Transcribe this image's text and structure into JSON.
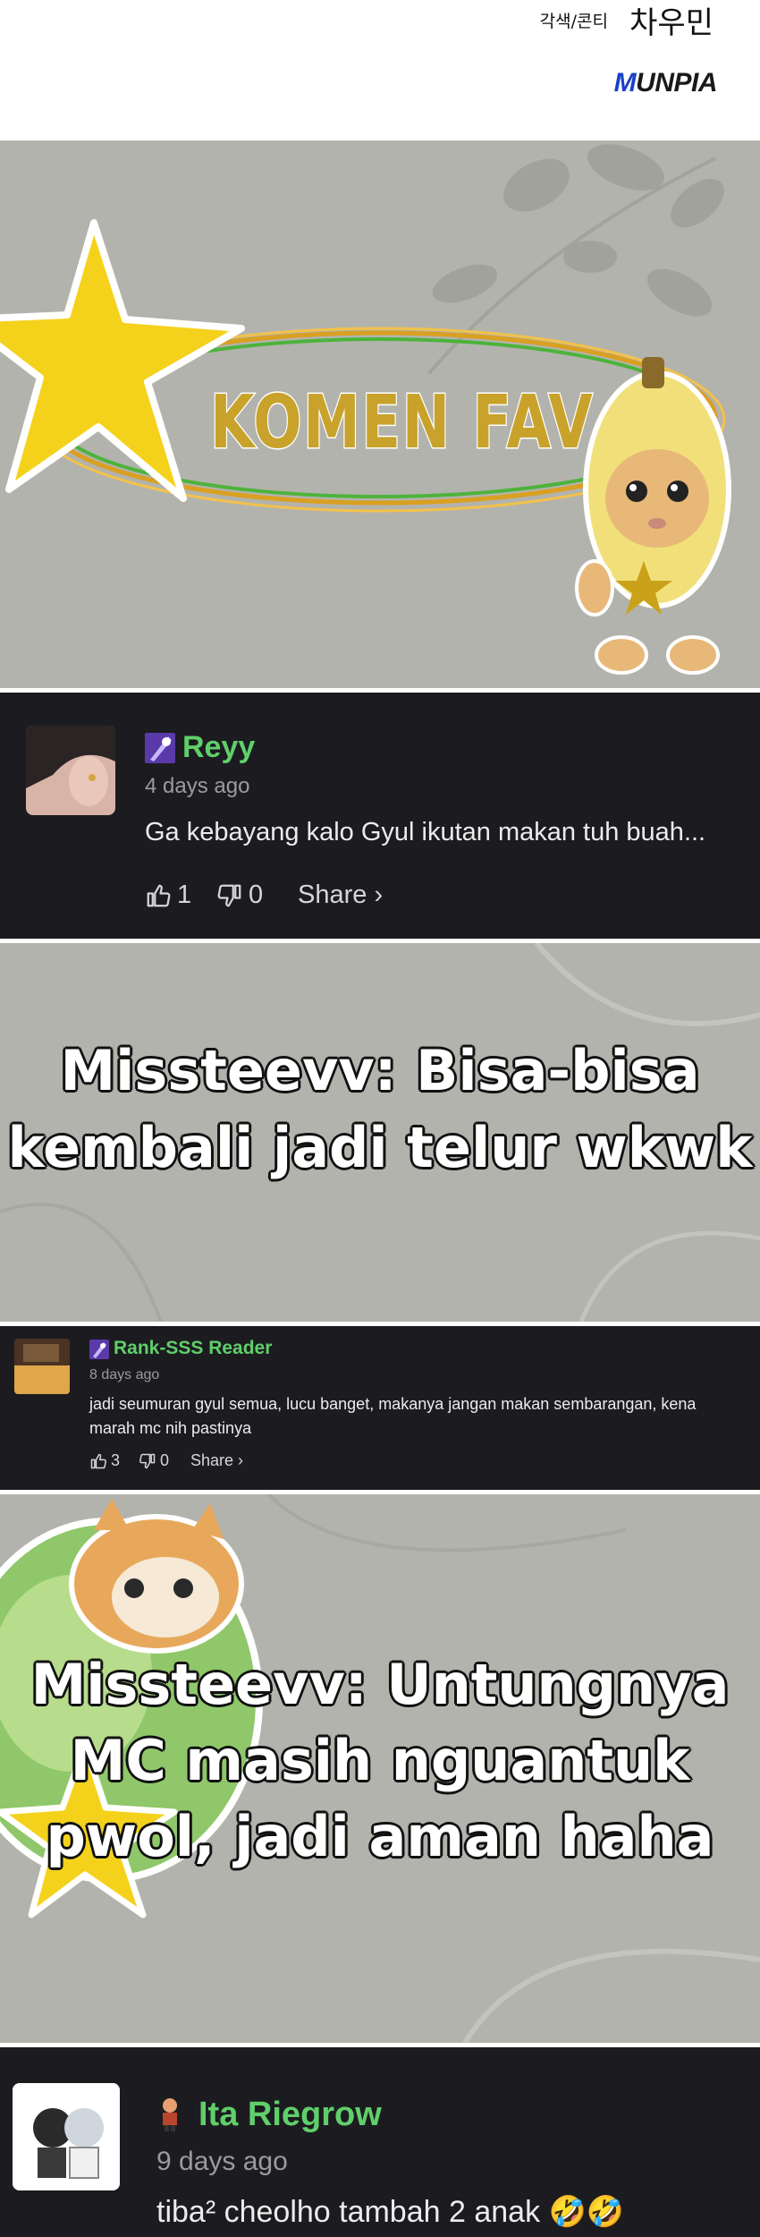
{
  "header": {
    "credit_role": "각색/콘티",
    "credit_name": "차우민",
    "brand_m": "M",
    "brand_rest": "UNPIA"
  },
  "banner": {
    "title": "KOMEN FAV"
  },
  "comments": [
    {
      "username": "Reyy",
      "time": "4 days ago",
      "text": "Ga kebayang kalo Gyul ikutan makan tuh buah...",
      "likes": "1",
      "dislikes": "0",
      "share": "Share ›"
    },
    {
      "username": "Rank-SSS Reader",
      "time": "8 days ago",
      "text_line1": "jadi seumuran gyul semua, lucu banget, makanya jangan makan sembarangan, kena",
      "text_line2": "marah mc nih pastinya",
      "likes": "3",
      "dislikes": "0",
      "share": "Share ›"
    },
    {
      "username": "Ita Riegrow",
      "time": "9 days ago",
      "text": "tiba² cheolho tambah 2 anak 🤣🤣"
    }
  ],
  "replies": [
    {
      "line1": "Missteevv: Bisa-bisa",
      "line2": "kembali jadi telur wkwk"
    },
    {
      "line1": "Missteevv: Untungnya",
      "line2": "MC masih nguantuk",
      "line3": "pwol, jadi aman haha"
    }
  ],
  "colors": {
    "username_green": "#5fcf6a",
    "card_bg": "#1c1c20",
    "panel_gray": "#b3b3ad",
    "brand_blue": "#1a3fc8"
  }
}
